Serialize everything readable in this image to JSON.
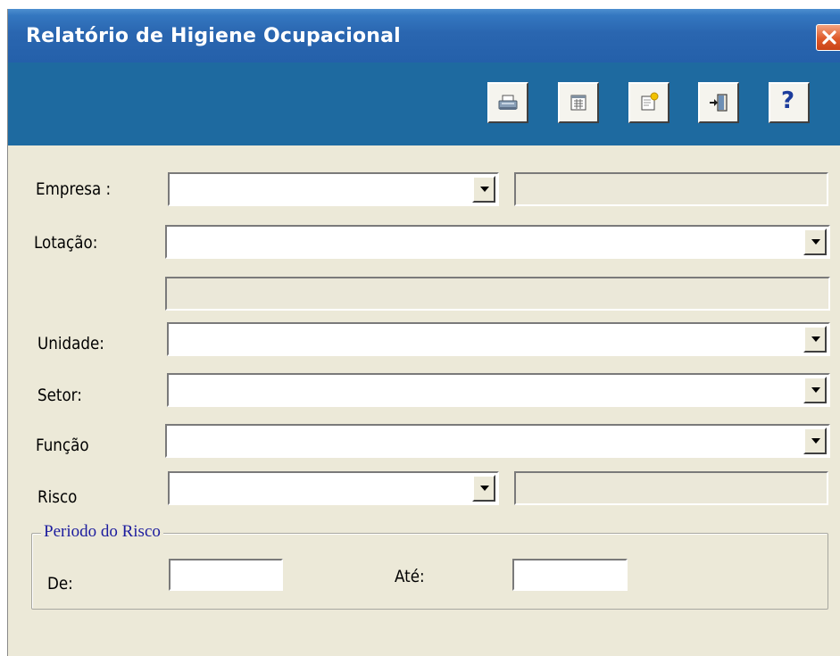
{
  "window": {
    "title": "Relatório de Higiene Ocupacional"
  },
  "toolbar": {
    "buttons": [
      {
        "name": "print",
        "icon": "printer-icon"
      },
      {
        "name": "preview",
        "icon": "report-grid-icon"
      },
      {
        "name": "edit",
        "icon": "edit-document-icon"
      },
      {
        "name": "exit",
        "icon": "exit-door-icon"
      },
      {
        "name": "help",
        "icon": "help-icon",
        "glyph": "?"
      }
    ]
  },
  "form": {
    "empresa": {
      "label": "Empresa :",
      "value": "",
      "description": ""
    },
    "lotacao": {
      "label": "Lotação:",
      "value": "",
      "description": ""
    },
    "unidade": {
      "label": "Unidade:",
      "value": ""
    },
    "setor": {
      "label": "Setor:",
      "value": ""
    },
    "funcao": {
      "label": "Função",
      "value": ""
    },
    "risco": {
      "label": "Risco",
      "value": "",
      "description": ""
    },
    "periodo": {
      "legend": "Periodo do Risco",
      "de": {
        "label": "De:",
        "value": ""
      },
      "ate": {
        "label": "Até:",
        "value": ""
      }
    }
  },
  "colors": {
    "titlebar": "#2a66b0",
    "toolbar": "#1e6aa0",
    "window_bg": "#ece9d8",
    "readonly_bg": "#ebe8d9",
    "legend_text": "#1c1c9e",
    "close_button": "#df5a2a"
  }
}
